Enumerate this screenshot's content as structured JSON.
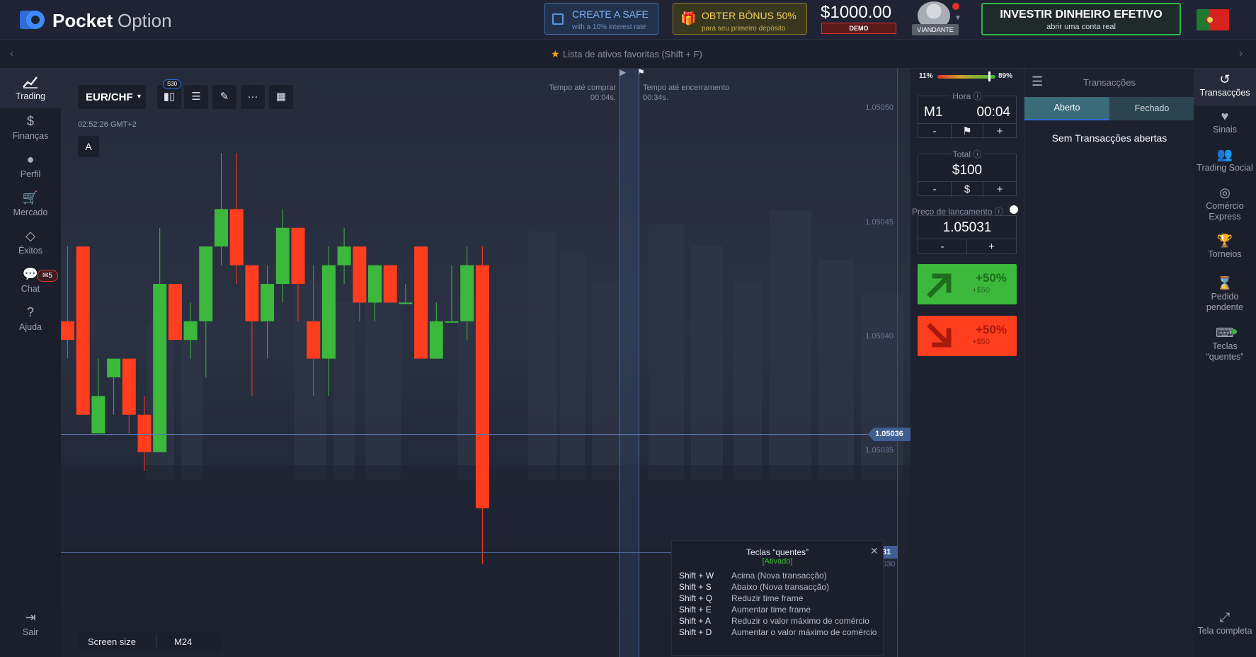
{
  "brand": {
    "name_bold": "Pocket",
    "name_light": "Option"
  },
  "header": {
    "safe_title": "CREATE A SAFE",
    "safe_sub": "with a 10% interest rate",
    "bonus_title": "OBTER BÔNUS 50%",
    "bonus_sub": "para seu primeiro depósito",
    "balance": "$1000.00",
    "balance_mode": "DEMO",
    "avatar_label": "VIANDANTE",
    "invest_title": "INVESTIR DINHEIRO EFETIVO",
    "invest_sub": "abrir uma conta real"
  },
  "subbar": {
    "favorites": "Lista de ativos favoritas (Shift + F)"
  },
  "leftnav": [
    {
      "label": "Trading",
      "icon": "chart-line-icon"
    },
    {
      "label": "Finanças",
      "icon": "dollar-icon"
    },
    {
      "label": "Perfil",
      "icon": "user-icon"
    },
    {
      "label": "Mercado",
      "icon": "cart-icon"
    },
    {
      "label": "Êxitos",
      "icon": "diamond-icon"
    },
    {
      "label": "Chat",
      "icon": "chat-icon"
    },
    {
      "label": "Ajuda",
      "icon": "help-icon"
    }
  ],
  "chat_badge": "5",
  "logout": "Sair",
  "chart": {
    "asset": "EUR/CHF",
    "timeframe_badge": "S30",
    "time": "02:52:26 GMT+2",
    "drawing_letter": "A",
    "buy_time_label": "Tempo até comprar",
    "buy_time_value": "00:04s.",
    "close_time_label": "Tempo até encerramento",
    "close_time_value": "00:34s.",
    "price_labels": [
      "1.05050",
      "1.05045",
      "1.05040",
      "1.05035"
    ],
    "current_price_tag": "1.05036",
    "lower_price_tag": "031",
    "lower_price_tag2": "030",
    "screen_size_label": "Screen size",
    "screen_size_value": "M24"
  },
  "chart_data": {
    "type": "candlestick",
    "ylim": [
      1.05028,
      1.05053
    ],
    "candles": [
      {
        "o": 1.05041,
        "c": 1.0504,
        "h": 1.05045,
        "l": 1.05039
      },
      {
        "o": 1.05045,
        "c": 1.05036,
        "h": 1.05045,
        "l": 1.05036
      },
      {
        "o": 1.05035,
        "c": 1.05037,
        "h": 1.05039,
        "l": 1.05035
      },
      {
        "o": 1.05038,
        "c": 1.05039,
        "h": 1.05039,
        "l": 1.05036
      },
      {
        "o": 1.05039,
        "c": 1.05036,
        "h": 1.05039,
        "l": 1.05035
      },
      {
        "o": 1.05036,
        "c": 1.05034,
        "h": 1.05037,
        "l": 1.05033
      },
      {
        "o": 1.05034,
        "c": 1.05043,
        "h": 1.05046,
        "l": 1.05034
      },
      {
        "o": 1.05043,
        "c": 1.0504,
        "h": 1.05043,
        "l": 1.0504
      },
      {
        "o": 1.0504,
        "c": 1.05041,
        "h": 1.05042,
        "l": 1.05039
      },
      {
        "o": 1.05041,
        "c": 1.05045,
        "h": 1.05045,
        "l": 1.05038
      },
      {
        "o": 1.05045,
        "c": 1.05047,
        "h": 1.0505,
        "l": 1.05044
      },
      {
        "o": 1.05047,
        "c": 1.05044,
        "h": 1.0505,
        "l": 1.05043
      },
      {
        "o": 1.05044,
        "c": 1.05041,
        "h": 1.05044,
        "l": 1.05037
      },
      {
        "o": 1.05041,
        "c": 1.05043,
        "h": 1.05044,
        "l": 1.05039
      },
      {
        "o": 1.05043,
        "c": 1.05046,
        "h": 1.05047,
        "l": 1.05042
      },
      {
        "o": 1.05046,
        "c": 1.05043,
        "h": 1.05046,
        "l": 1.05041
      },
      {
        "o": 1.05041,
        "c": 1.05039,
        "h": 1.05044,
        "l": 1.05037
      },
      {
        "o": 1.05039,
        "c": 1.05044,
        "h": 1.05045,
        "l": 1.05037
      },
      {
        "o": 1.05044,
        "c": 1.05045,
        "h": 1.05046,
        "l": 1.05043
      },
      {
        "o": 1.05045,
        "c": 1.05042,
        "h": 1.05045,
        "l": 1.05041
      },
      {
        "o": 1.05042,
        "c": 1.05044,
        "h": 1.05044,
        "l": 1.05041
      },
      {
        "o": 1.05044,
        "c": 1.05042,
        "h": 1.05044,
        "l": 1.05042
      },
      {
        "o": 1.05042,
        "c": 1.05042,
        "h": 1.05043,
        "l": 1.05042
      },
      {
        "o": 1.05045,
        "c": 1.05039,
        "h": 1.05045,
        "l": 1.05039
      },
      {
        "o": 1.05039,
        "c": 1.05041,
        "h": 1.05042,
        "l": 1.05039
      },
      {
        "o": 1.05041,
        "c": 1.05041,
        "h": 1.05044,
        "l": 1.05041
      },
      {
        "o": 1.05041,
        "c": 1.05044,
        "h": 1.05045,
        "l": 1.0504
      },
      {
        "o": 1.05044,
        "c": 1.05031,
        "h": 1.05045,
        "l": 1.05028
      }
    ]
  },
  "trade": {
    "sentiment_low": "11%",
    "sentiment_high": "89%",
    "time_label": "Hora",
    "timeframe": "M1",
    "time_value": "00:04",
    "total_label": "Total",
    "amount": "$100",
    "launch_label": "Preço de lançamento",
    "launch_price": "1.05031",
    "up_pct": "+50%",
    "up_amt": "+$50",
    "down_pct": "+50%",
    "down_amt": "+$50",
    "minus": "-",
    "plus": "+",
    "dollar": "$"
  },
  "transactions": {
    "title": "Transacções",
    "tab_open": "Aberto",
    "tab_closed": "Fechado",
    "empty": "Sem Transacções abertas"
  },
  "rightnav": [
    {
      "label": "Transacções",
      "icon": "history-icon"
    },
    {
      "label": "Sinais",
      "icon": "heartbeat-icon"
    },
    {
      "label": "Trading Social",
      "icon": "users-icon"
    },
    {
      "label": "Comércio Express",
      "icon": "target-icon"
    },
    {
      "label": "Torneios",
      "icon": "trophy-icon"
    },
    {
      "label": "Pedido pendente",
      "icon": "hourglass-icon"
    },
    {
      "label": "Teclas “quentes”",
      "icon": "keyboard-icon"
    }
  ],
  "fullscreen": "Tela completa",
  "hotkeys": {
    "title": "Teclas “quentes”",
    "status": "[Ativado]",
    "rows": [
      {
        "key": "Shift + W",
        "desc": "Acima (Nova transacção)"
      },
      {
        "key": "Shift + S",
        "desc": "Abaixo (Nova transacção)"
      },
      {
        "key": "Shift + Q",
        "desc": "Reduzir time frame"
      },
      {
        "key": "Shift + E",
        "desc": "Aumentar time frame"
      },
      {
        "key": "Shift + A",
        "desc": "Reduzir o valor máximo de comércio"
      },
      {
        "key": "Shift + D",
        "desc": "Aumentar o valor máximo de comércio"
      }
    ]
  },
  "colors": {
    "up": "#3cb93c",
    "down": "#ff3d1f",
    "accent": "#2f6cd8"
  }
}
